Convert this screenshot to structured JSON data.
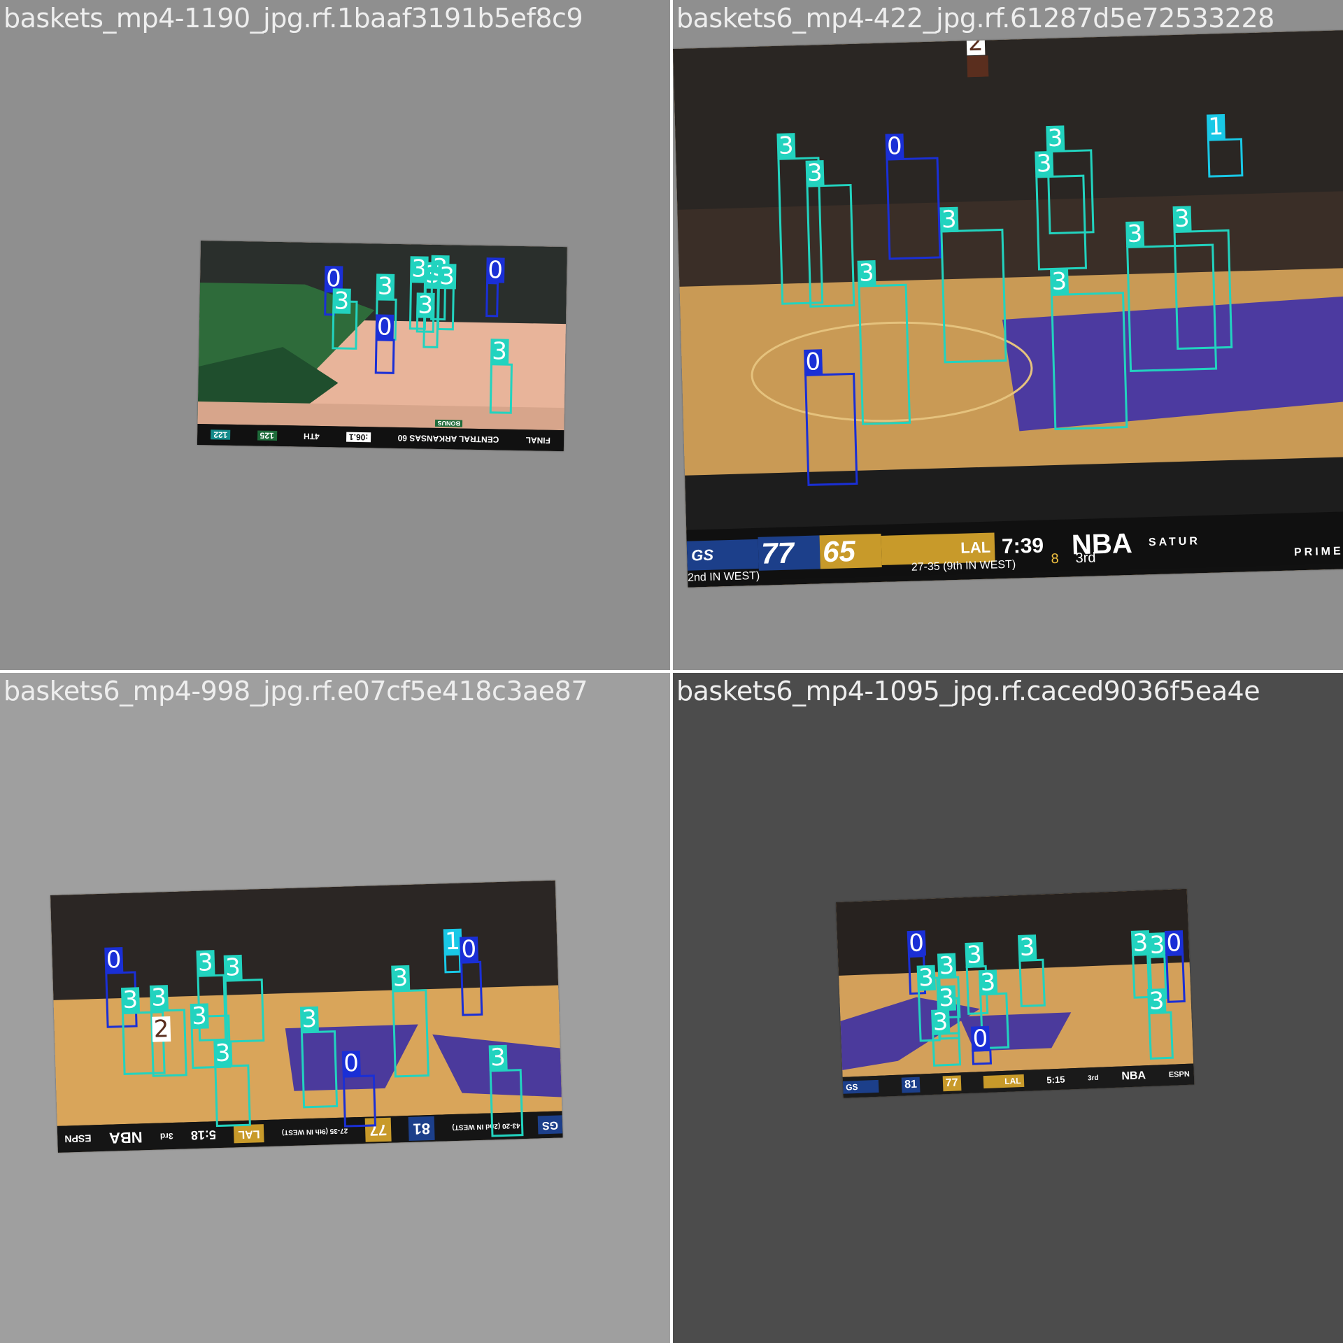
{
  "colors": {
    "class0": "#1a2fd6",
    "class1": "#19c8e6",
    "class2": "#5a2e1e",
    "class3": "#22d3bf"
  },
  "tiles": [
    {
      "title": "baskets_mp4-1190_jpg.rf.1baaf3191b5ef8c9"
    },
    {
      "title": "baskets6_mp4-422_jpg.rf.61287d5e72533228"
    },
    {
      "title": "baskets6_mp4-998_jpg.rf.e07cf5e418c3ae87"
    },
    {
      "title": "baskets6_mp4-1095_jpg.rf.caced9036f5ea4e"
    }
  ],
  "scoreboard_422": {
    "away": "GS",
    "away_score": "77",
    "home_score": "65",
    "home": "LAL",
    "clock": "7:39",
    "period": "3rd",
    "quarter_fouls": "8",
    "away_record": "2nd IN WEST)",
    "home_record": "27-35 (9th IN WEST)",
    "brand": "NBA",
    "network_top": "SATUR",
    "network_bottom": "PRIMET"
  },
  "scoreboard_1190": {
    "left": "FINAL",
    "mid": "CENTRAL ARKANSAS 60",
    "bonus": "BONUS",
    "score_a": "125",
    "score_b": "122",
    "clock": ":06.1",
    "quarter": "4TH"
  },
  "scoreboard_998": {
    "away": "GS",
    "away_score": "81",
    "home_score": "77",
    "home": "LAL",
    "clock": "5:18",
    "period": "3rd",
    "brand": "NBA",
    "network": "ESPN",
    "record": "27-35 (9th IN WEST)",
    "away_record": "43-20 (2nd IN WEST)"
  },
  "scoreboard_1095": {
    "away": "GS",
    "away_score": "81",
    "home_score": "77",
    "home": "LAL",
    "clock": "5:15",
    "period": "3rd",
    "brand": "NBA",
    "network": "ESPN"
  },
  "boxes": {
    "t1190": [
      {
        "c": "0"
      },
      {
        "c": "3"
      },
      {
        "c": "3"
      },
      {
        "c": "0"
      },
      {
        "c": "3"
      },
      {
        "c": "3"
      },
      {
        "c": "3"
      },
      {
        "c": "3"
      },
      {
        "c": "3"
      },
      {
        "c": "0"
      },
      {
        "c": "3"
      }
    ],
    "t422": [
      {
        "c": "2"
      },
      {
        "c": "3"
      },
      {
        "c": "3"
      },
      {
        "c": "0"
      },
      {
        "c": "3"
      },
      {
        "c": "3"
      },
      {
        "c": "1"
      },
      {
        "c": "3"
      },
      {
        "c": "3"
      },
      {
        "c": "3"
      },
      {
        "c": "3"
      },
      {
        "c": "3"
      },
      {
        "c": "0"
      }
    ],
    "t998": [
      {
        "c": "0"
      },
      {
        "c": "3"
      },
      {
        "c": "3"
      },
      {
        "c": "3"
      },
      {
        "c": "3"
      },
      {
        "c": "2"
      },
      {
        "c": "3"
      },
      {
        "c": "3"
      },
      {
        "c": "3"
      },
      {
        "c": "1"
      },
      {
        "c": "0"
      },
      {
        "c": "3"
      },
      {
        "c": "0"
      },
      {
        "c": "3"
      }
    ],
    "t1095": [
      {
        "c": "0"
      },
      {
        "c": "3"
      },
      {
        "c": "3"
      },
      {
        "c": "3"
      },
      {
        "c": "3"
      },
      {
        "c": "3"
      },
      {
        "c": "3"
      },
      {
        "c": "3"
      },
      {
        "c": "0"
      },
      {
        "c": "3"
      },
      {
        "c": "3"
      },
      {
        "c": "0"
      },
      {
        "c": "3"
      }
    ]
  }
}
